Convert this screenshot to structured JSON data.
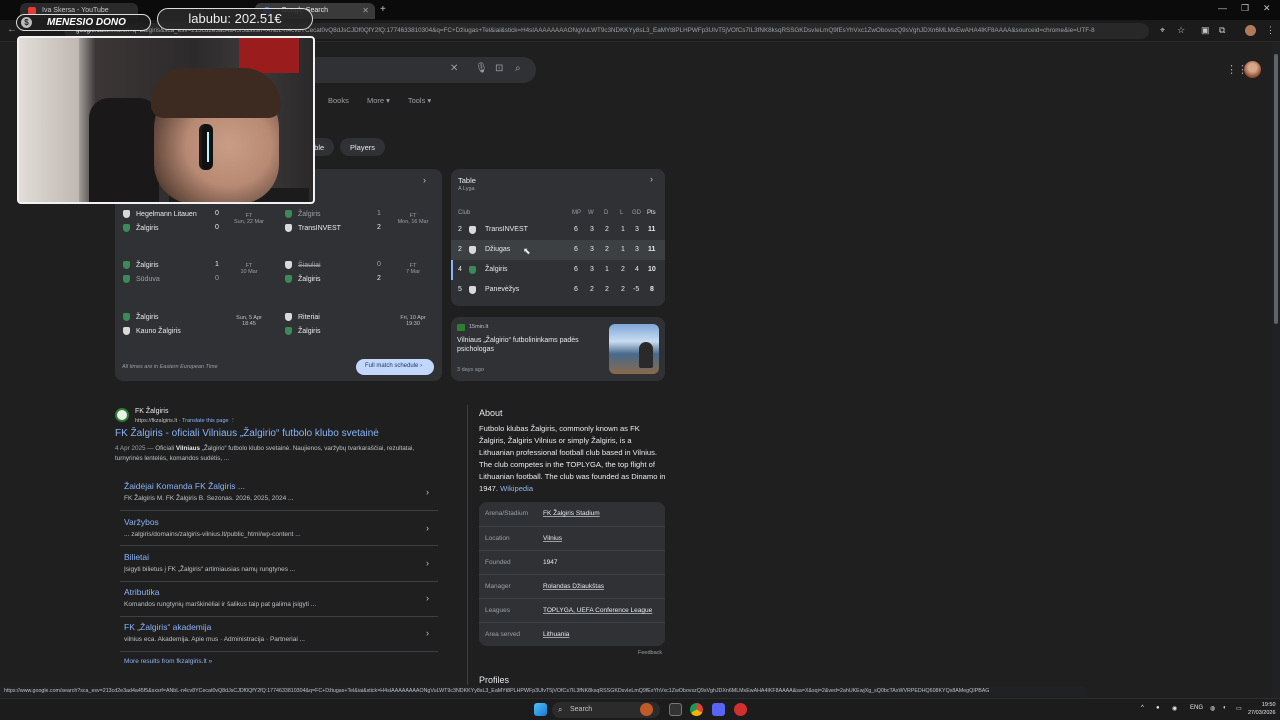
{
  "browser": {
    "tabs": [
      {
        "title": "Iva Skersa - YouTube"
      },
      {
        "title": "- Google Search"
      }
    ],
    "url_host": "google.com",
    "url_rest": "/search?q=Žalgiris&sca_esv=213cd2e3ad4a45f5&sxsrf=ANbL-n4cv8YCecat0vQ8dJsCJDf0QfY2fQ:1774633810304&q=FC+Džiugas+Tel&iai&stick=H4sIAAAAAAAAONgVuLWT9c3NDKKYy8sL3_EaMYt8PLHPWFp3UIvT5jVOfCs7IL3fNK8ksqRSSGKDsvIeLmQ9fEsYhVxc1ZwObovszQ9sVghJDXn6MLMxEwAHA4IKF8AAAA&sourceid=chrome&ie=UTF-8",
    "status_url": "https://www.google.com/search?sca_esv=213cd2e3ad4a45f5&sxsrf=ANbL-n4cv8YCecat0vQ8dJsCJDf0QfY2fQ:1774633810304&q=FC+Džiugas+Tel&iai&stick=H4sIAAAAAAAAONgVuLWT9c3NDKKYy8sL3_EaMYt8PLHPWFp3UIvT5jVOfCs7IL3fNK8ksqRSSGKDsvIeLmQ9fEsYhVxc1ZwObovszQ9sVghJDXn6MLMxEwAHA4IKF8AAAA&sa=X&sqi=2&ved=2ahUKEwjXg_sQ0bcTAxWVRPEDHQ608KYQx8AMegQIPBAG"
  },
  "stream": {
    "dono_name": "MENESIO DONO",
    "dono_amount": "labubu: 202.51€"
  },
  "google": {
    "tabs": [
      "Books",
      "More ▾",
      "Tools ▾"
    ],
    "chips": [
      "able",
      "Players"
    ]
  },
  "matches": {
    "games": [
      {
        "home": "Hegelmann Litauen",
        "home_score": "0",
        "away": "Žalgiris",
        "away_score": "0",
        "status": "FT",
        "date": "Sun, 22 Mar"
      },
      {
        "home": "Žalgiris",
        "home_score": "1",
        "away": "TransINVEST",
        "away_score": "2",
        "status": "FT",
        "date": "Mon, 16 Mar"
      },
      {
        "home": "Žalgiris",
        "home_score": "1",
        "away": "Sūduva",
        "away_score": "0",
        "status": "FT",
        "date": "10 Mar"
      },
      {
        "home": "Šiauliai",
        "home_score": "0",
        "away": "Žalgiris",
        "away_score": "2",
        "status": "FT",
        "date": "7 Mar"
      },
      {
        "home": "Žalgiris",
        "away": "Kauno Žalgiris",
        "date": "Sun, 5 Apr",
        "time": "18:45"
      },
      {
        "home": "Riteriai",
        "away": "Žalgiris",
        "date": "Fri, 10 Apr",
        "time": "19:30"
      }
    ],
    "footnote": "All times are in Eastern European Time",
    "schedule_button": "Full match schedule"
  },
  "table": {
    "title": "Table",
    "league": "A Lyga",
    "headers": [
      "Club",
      "MP",
      "W",
      "D",
      "L",
      "GD",
      "Pts"
    ],
    "rows": [
      {
        "pos": "2",
        "club": "TransINVEST",
        "mp": "6",
        "w": "3",
        "d": "2",
        "l": "1",
        "gd": "3",
        "pts": "11"
      },
      {
        "pos": "2",
        "club": "Džiugas",
        "mp": "6",
        "w": "3",
        "d": "2",
        "l": "1",
        "gd": "3",
        "pts": "11"
      },
      {
        "pos": "4",
        "club": "Žalgiris",
        "mp": "6",
        "w": "3",
        "d": "1",
        "l": "2",
        "gd": "4",
        "pts": "10"
      },
      {
        "pos": "5",
        "club": "Panevėžys",
        "mp": "6",
        "w": "2",
        "d": "2",
        "l": "2",
        "gd": "-5",
        "pts": "8"
      }
    ]
  },
  "news": {
    "source": "15min.lt",
    "headline": "Vilniaus „Žalgirio“ futbolininkams padės psichologas",
    "age": "3 days ago"
  },
  "result": {
    "site_name": "FK Žalgiris",
    "site_url": "https://fkzalgiris.lt",
    "translate": "Translate this page",
    "title": "FK Žalgiris - oficiali Vilniaus „Žalgirio“ futbolo klubo svetainė",
    "snippet_date": "4 Apr 2025 —",
    "snippet_pre": " Oficiali ",
    "snippet_bold": "Vilniaus",
    "snippet_post": " „Žalgirio“ futbolo klubo svetainė. Naujienos, varžybų tvarkaraščiai, rezultatai, turnyrinės lentelės, komandos sudėtis, ...",
    "sublinks": [
      {
        "title": "Žaidėjai Komanda FK Žalgiris ...",
        "desc": "FK Žalgiris M. FK Žalgiris B. Sezonas. 2026, 2025, 2024 ..."
      },
      {
        "title": "Varžybos",
        "desc": "... zalgiris/domains/zalgiris-vilnius.lt/public_html/wp-content ..."
      },
      {
        "title": "Bilietai",
        "desc": "Įsigyti bilietus į FK „Žalgiris“ artimiausias namų rungtynes ..."
      },
      {
        "title": "Atributika",
        "desc": "Komandos rungtynių marškinėliai ir šalikus taip pat galima įsigyti ..."
      },
      {
        "title": "FK „Žalgiris“ akademija",
        "desc": "vilnius eca. Akademija. Apie mus · Administracija · Partneriai ..."
      }
    ],
    "more": "More results from fkzalgiris.lt »"
  },
  "about": {
    "heading": "About",
    "text": "Futbolo klubas Žalgiris, commonly known as FK Žalgiris, Žalgiris Vilnius or simply Žalgiris, is a Lithuanian professional football club based in Vilnius. The club competes in the TOPLYGA, the top flight of Lithuanian football. The club was founded as Dinamo in 1947.",
    "source_link": "Wikipedia",
    "facts": [
      {
        "key": "Arena/Stadium",
        "value": "FK Žalgiris Stadium"
      },
      {
        "key": "Location",
        "value": "Vilnius"
      },
      {
        "key": "Founded",
        "value": "1947"
      },
      {
        "key": "Manager",
        "value": "Rolandas Džiaukštas"
      },
      {
        "key": "Leagues",
        "value": "TOPLYGA, UEFA Conference League"
      },
      {
        "key": "Area served",
        "value": "Lithuania"
      }
    ],
    "feedback": "Feedback",
    "profiles": "Profiles"
  },
  "taskbar": {
    "search": "Search",
    "lang": "ENG",
    "time": "19:50",
    "date": "27/03/2026"
  },
  "colors": {
    "accent_link": "#8ab4f8",
    "panel": "#303134",
    "background": "#1f1f1f",
    "club_green": "#3c8a57"
  }
}
